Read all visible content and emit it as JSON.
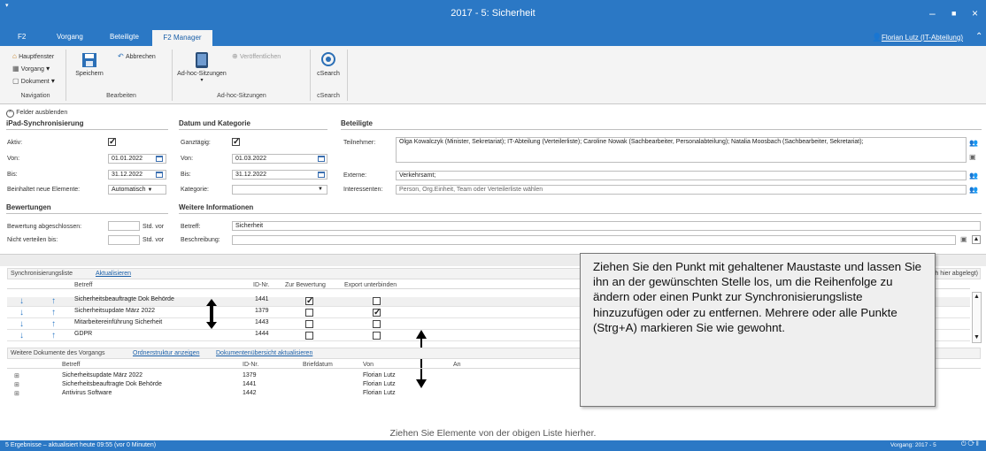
{
  "window": {
    "title": "2017 - 5: Sicherheit"
  },
  "tabs": [
    "F2",
    "Vorgang",
    "Beteiligte",
    "F2 Manager"
  ],
  "user": "Florian Lutz (IT-Abteilung)",
  "ribbon": {
    "nav": {
      "items": [
        "Hauptfenster",
        "Vorgang",
        "Dokument"
      ],
      "group": "Navigation"
    },
    "edit": {
      "save": "Speichern",
      "cancel": "Abbrechen",
      "group": "Bearbeiten"
    },
    "adhoc": {
      "sessions": "Ad-hoc-Sitzungen",
      "publish": "Veröffentlichen",
      "group": "Ad-hoc-Sitzungen"
    },
    "csearch": {
      "button": "cSearch",
      "group": "cSearch"
    }
  },
  "fields_toggle": "Felder ausblenden",
  "ipad": {
    "title": "iPad-Synchronisierung",
    "active_label": "Aktiv:",
    "from_label": "Von:",
    "from": "01.01.2022",
    "to_label": "Bis:",
    "to": "31.12.2022",
    "includes_label": "Beinhaltet neue Elemente:",
    "includes": "Automatisch"
  },
  "date_cat": {
    "title": "Datum und Kategorie",
    "allday_label": "Ganztägig:",
    "from_label": "Von:",
    "from": "01.03.2022",
    "to_label": "Bis:",
    "to": "31.12.2022",
    "cat_label": "Kategorie:",
    "category": ""
  },
  "participants": {
    "title": "Beteiligte",
    "members_label": "Teilnehmer:",
    "members": "Olga Kowalczyk (Minister, Sekretariat); IT-Abteilung (Verteilerliste); Caroline Nowak (Sachbearbeiter, Personalabteilung); Natalia Moosbach (Sachbearbeiter, Sekretariat);",
    "external_label": "Externe:",
    "external": "Verkehrsamt;",
    "interested_label": "Interessenten:",
    "interested_placeholder": "Person, Org.Einheit, Team oder Verteilerliste wählen"
  },
  "ratings": {
    "title": "Bewertungen",
    "closed_label": "Bewertung abgeschlossen:",
    "closed_unit": "Std. vor",
    "nodist_label": "Nicht verteilen bis:",
    "nodist_unit": "Std. vor"
  },
  "more": {
    "title": "Weitere Informationen",
    "subject_label": "Betreff:",
    "subject": "Sicherheit",
    "desc_label": "Beschreibung:",
    "desc": ""
  },
  "sync": {
    "title": "Synchronisierungsliste",
    "refresh": "Aktualisieren",
    "note": "(Neue Dokumente des Vorgangs werden automatisch hier abgelegt)",
    "headers": [
      "Betreff",
      "ID-Nr.",
      "Zur Bewertung",
      "Export unterbinden"
    ],
    "rows": [
      {
        "subject": "Sicherheitsbeauftragte Dok Behörde",
        "id": "1441",
        "review": true,
        "noexport": false
      },
      {
        "subject": "Sicherheitsupdate März 2022",
        "id": "1379",
        "review": false,
        "noexport": true
      },
      {
        "subject": "Mitarbeitereinführung Sicherheit",
        "id": "1443",
        "review": false,
        "noexport": false
      },
      {
        "subject": "GDPR",
        "id": "1444",
        "review": false,
        "noexport": false
      }
    ]
  },
  "docs": {
    "title": "Weitere Dokumente des Vorgangs",
    "show_folders": "Ordnerstruktur anzeigen",
    "refresh_overview": "Dokumentenübersicht aktualisieren",
    "headers": [
      "Betreff",
      "ID-Nr.",
      "Briefdatum",
      "Von",
      "An"
    ],
    "rows": [
      {
        "subject": "Sicherheitsupdate März 2022",
        "id": "1379",
        "date": "",
        "from": "Florian Lutz"
      },
      {
        "subject": "Sicherheitsbeauftragte Dok Behörde",
        "id": "1441",
        "date": "",
        "from": "Florian Lutz"
      },
      {
        "subject": "Antivirus Software",
        "id": "1442",
        "date": "",
        "from": "Florian Lutz"
      }
    ],
    "drop_hint": "Ziehen Sie Elemente von der obigen Liste hierher."
  },
  "tooltip": "Ziehen Sie den Punkt mit gehaltener Maustaste und lassen Sie ihn an der gewünschten Stelle los, um die Reihenfolge zu ändern oder einen Punkt zur Synchronisierungsliste hinzuzufügen oder zu entfernen. Mehrere oder alle Punkte (Strg+A) markieren Sie wie gewohnt.",
  "status": {
    "left": "5 Ergebnisse – aktualisiert heute 09:55 (vor 0 Minuten)",
    "right": "Vorgang: 2017 - 5"
  },
  "colors": {
    "accent": "#2b78c5",
    "link": "#1a5fa8"
  }
}
